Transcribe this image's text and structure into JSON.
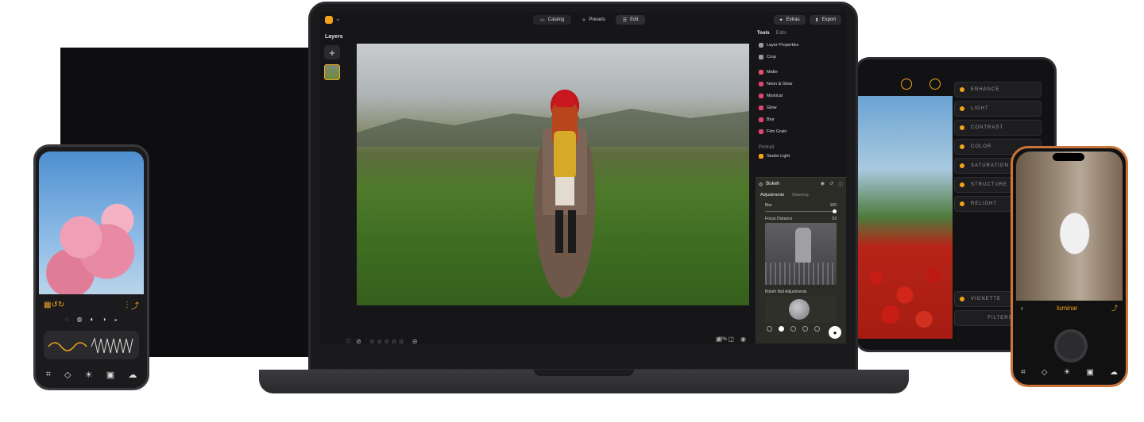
{
  "app": {
    "layers_title": "Layers",
    "add_layer_label": "+"
  },
  "nav": {
    "tabs": [
      {
        "label": "Catalog",
        "icon": "folder-icon"
      },
      {
        "label": "Presets",
        "icon": "presets-icon"
      },
      {
        "label": "Edit",
        "icon": "sliders-icon"
      }
    ],
    "extras_label": "Extras",
    "export_label": "Export"
  },
  "tools_panel": {
    "tab_tools": "Tools",
    "tab_edits": "Edits",
    "items": [
      {
        "label": "Layer Properties",
        "color": "#9a9aa0"
      },
      {
        "label": "Crop",
        "color": "#9a9aa0"
      },
      {
        "label": "Matte",
        "color": "#e5526b"
      },
      {
        "label": "Neon & Glow",
        "color": "#e0466d"
      },
      {
        "label": "Mystical",
        "color": "#e0466d"
      },
      {
        "label": "Glow",
        "color": "#e0466d"
      },
      {
        "label": "Blur",
        "color": "#e0466d"
      },
      {
        "label": "Film Grain",
        "color": "#e0466d"
      }
    ],
    "section_portrait": "Portrait",
    "studio_light": "Studio Light"
  },
  "bokeh": {
    "title": "Bokeh",
    "tab_adjustments": "Adjustments",
    "tab_masking": "Masking",
    "blur_label": "Blur",
    "blur_value": "100",
    "focus_label": "Focus Distance",
    "focus_value": "53",
    "ball_label": "Bokeh Ball Adjustments"
  },
  "bottom": {
    "zoom": "42%"
  },
  "tablet": {
    "items": [
      "ENHANCE",
      "LIGHT",
      "CONTRAST",
      "COLOR",
      "SATURATION",
      "STRUCTURE",
      "RELIGHT",
      "VIGNETTE"
    ],
    "filters_label": "FILTERS"
  },
  "phone_right": {
    "brand": "luminar"
  },
  "colors": {
    "accent": "#f2a31b"
  }
}
